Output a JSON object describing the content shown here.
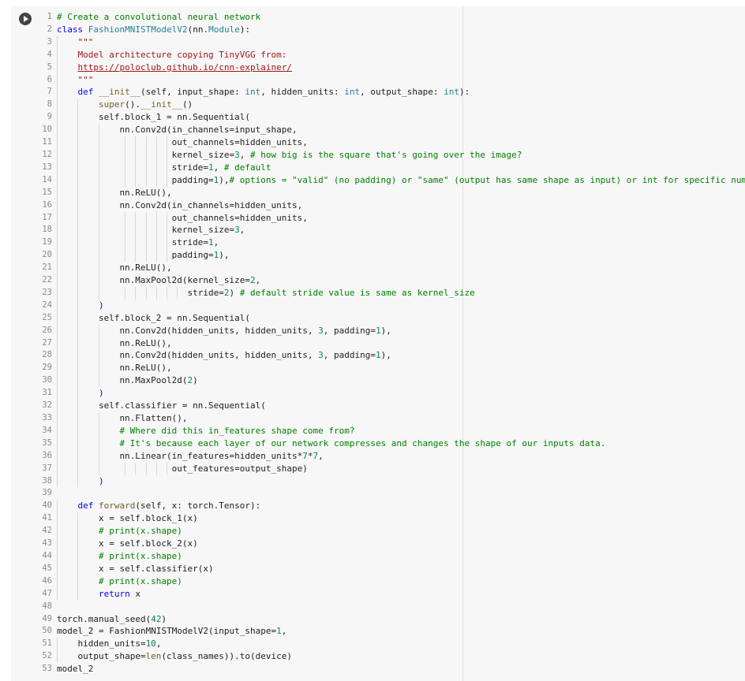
{
  "cell": {
    "run_button_label": "Run cell",
    "lines": [
      {
        "num": "1",
        "indent": 0,
        "tokens": [
          [
            "cmt",
            "# Create a convolutional neural network"
          ]
        ]
      },
      {
        "num": "2",
        "indent": 0,
        "tokens": [
          [
            "kw",
            "class "
          ],
          [
            "cls",
            "FashionMNISTModelV2"
          ],
          [
            "",
            "(nn."
          ],
          [
            "cls",
            "Module"
          ],
          [
            "",
            "):"
          ]
        ]
      },
      {
        "num": "3",
        "indent": 1,
        "tokens": [
          [
            "str",
            "\"\"\""
          ]
        ]
      },
      {
        "num": "4",
        "indent": 1,
        "tokens": [
          [
            "str",
            "Model architecture copying TinyVGG from:"
          ]
        ]
      },
      {
        "num": "5",
        "indent": 1,
        "tokens": [
          [
            "link",
            "https://poloclub.github.io/cnn-explainer/"
          ]
        ]
      },
      {
        "num": "6",
        "indent": 1,
        "tokens": [
          [
            "str",
            "\"\"\""
          ]
        ]
      },
      {
        "num": "7",
        "indent": 1,
        "tokens": [
          [
            "kw",
            "def "
          ],
          [
            "fn",
            "__init__"
          ],
          [
            "",
            "(self, input_shape: "
          ],
          [
            "cls",
            "int"
          ],
          [
            "",
            ", hidden_units: "
          ],
          [
            "cls",
            "int"
          ],
          [
            "",
            ", output_shape: "
          ],
          [
            "cls",
            "int"
          ],
          [
            "",
            "):"
          ]
        ]
      },
      {
        "num": "8",
        "indent": 2,
        "tokens": [
          [
            "fn",
            "super"
          ],
          [
            "",
            "()."
          ],
          [
            "fn",
            "__init__"
          ],
          [
            "",
            "()"
          ]
        ]
      },
      {
        "num": "9",
        "indent": 2,
        "tokens": [
          [
            "",
            "self.block_1 = nn.Sequential("
          ]
        ]
      },
      {
        "num": "10",
        "indent": 3,
        "tokens": [
          [
            "",
            "nn.Conv2d(in_channels=input_shape,"
          ]
        ]
      },
      {
        "num": "11",
        "indent": 3,
        "pad": "          ",
        "tokens": [
          [
            "",
            "out_channels=hidden_units,"
          ]
        ]
      },
      {
        "num": "12",
        "indent": 3,
        "pad": "          ",
        "tokens": [
          [
            "",
            "kernel_size="
          ],
          [
            "num",
            "3"
          ],
          [
            "",
            ", "
          ],
          [
            "cmt",
            "# how big is the square that's going over the image?"
          ]
        ]
      },
      {
        "num": "13",
        "indent": 3,
        "pad": "          ",
        "tokens": [
          [
            "",
            "stride="
          ],
          [
            "num",
            "1"
          ],
          [
            "",
            ", "
          ],
          [
            "cmt",
            "# default"
          ]
        ]
      },
      {
        "num": "14",
        "indent": 3,
        "pad": "          ",
        "tokens": [
          [
            "",
            "padding="
          ],
          [
            "num",
            "1"
          ],
          [
            "",
            "),"
          ],
          [
            "cmt",
            "# options = \"valid\" (no padding) or \"same\" (output has same shape as input) or int for specific number"
          ]
        ]
      },
      {
        "num": "15",
        "indent": 3,
        "tokens": [
          [
            "",
            "nn.ReLU(),"
          ]
        ]
      },
      {
        "num": "16",
        "indent": 3,
        "tokens": [
          [
            "",
            "nn.Conv2d(in_channels=hidden_units,"
          ]
        ]
      },
      {
        "num": "17",
        "indent": 3,
        "pad": "          ",
        "tokens": [
          [
            "",
            "out_channels=hidden_units,"
          ]
        ]
      },
      {
        "num": "18",
        "indent": 3,
        "pad": "          ",
        "tokens": [
          [
            "",
            "kernel_size="
          ],
          [
            "num",
            "3"
          ],
          [
            "",
            ","
          ]
        ]
      },
      {
        "num": "19",
        "indent": 3,
        "pad": "          ",
        "tokens": [
          [
            "",
            "stride="
          ],
          [
            "num",
            "1"
          ],
          [
            "",
            ","
          ]
        ]
      },
      {
        "num": "20",
        "indent": 3,
        "pad": "          ",
        "tokens": [
          [
            "",
            "padding="
          ],
          [
            "num",
            "1"
          ],
          [
            "",
            "),"
          ]
        ]
      },
      {
        "num": "21",
        "indent": 3,
        "tokens": [
          [
            "",
            "nn.ReLU(),"
          ]
        ]
      },
      {
        "num": "22",
        "indent": 3,
        "tokens": [
          [
            "",
            "nn.MaxPool2d(kernel_size="
          ],
          [
            "num",
            "2"
          ],
          [
            "",
            ","
          ]
        ]
      },
      {
        "num": "23",
        "indent": 3,
        "pad": "             ",
        "tokens": [
          [
            "",
            "stride="
          ],
          [
            "num",
            "2"
          ],
          [
            "",
            ") "
          ],
          [
            "cmt",
            "# default stride value is same as kernel_size"
          ]
        ]
      },
      {
        "num": "24",
        "indent": 2,
        "tokens": [
          [
            "kw",
            ")"
          ]
        ]
      },
      {
        "num": "25",
        "indent": 2,
        "tokens": [
          [
            "",
            "self.block_2 = nn.Sequential("
          ]
        ]
      },
      {
        "num": "26",
        "indent": 3,
        "tokens": [
          [
            "",
            "nn.Conv2d(hidden_units, hidden_units, "
          ],
          [
            "num",
            "3"
          ],
          [
            "",
            ", padding="
          ],
          [
            "num",
            "1"
          ],
          [
            "",
            "),"
          ]
        ]
      },
      {
        "num": "27",
        "indent": 3,
        "tokens": [
          [
            "",
            "nn.ReLU(),"
          ]
        ]
      },
      {
        "num": "28",
        "indent": 3,
        "tokens": [
          [
            "",
            "nn.Conv2d(hidden_units, hidden_units, "
          ],
          [
            "num",
            "3"
          ],
          [
            "",
            ", padding="
          ],
          [
            "num",
            "1"
          ],
          [
            "",
            "),"
          ]
        ]
      },
      {
        "num": "29",
        "indent": 3,
        "tokens": [
          [
            "",
            "nn.ReLU(),"
          ]
        ]
      },
      {
        "num": "30",
        "indent": 3,
        "tokens": [
          [
            "",
            "nn.MaxPool2d("
          ],
          [
            "num",
            "2"
          ],
          [
            "",
            ")"
          ]
        ]
      },
      {
        "num": "31",
        "indent": 2,
        "tokens": [
          [
            "kw",
            ")"
          ]
        ]
      },
      {
        "num": "32",
        "indent": 2,
        "tokens": [
          [
            "",
            "self.classifier = nn.Sequential("
          ]
        ]
      },
      {
        "num": "33",
        "indent": 3,
        "tokens": [
          [
            "",
            "nn.Flatten(),"
          ]
        ]
      },
      {
        "num": "34",
        "indent": 3,
        "tokens": [
          [
            "cmt",
            "# Where did this in_features shape come from?"
          ]
        ]
      },
      {
        "num": "35",
        "indent": 3,
        "tokens": [
          [
            "cmt",
            "# It's because each layer of our network compresses and changes the shape of our inputs data."
          ]
        ]
      },
      {
        "num": "36",
        "indent": 3,
        "tokens": [
          [
            "",
            "nn.Linear(in_features=hidden_units*"
          ],
          [
            "num",
            "7"
          ],
          [
            "",
            "*"
          ],
          [
            "num",
            "7"
          ],
          [
            "",
            ","
          ]
        ]
      },
      {
        "num": "37",
        "indent": 3,
        "pad": "          ",
        "tokens": [
          [
            "",
            "out_features=output_shape)"
          ]
        ]
      },
      {
        "num": "38",
        "indent": 2,
        "tokens": [
          [
            "kw",
            ")"
          ]
        ]
      },
      {
        "num": "39",
        "indent": 0,
        "tokens": []
      },
      {
        "num": "40",
        "indent": 1,
        "tokens": [
          [
            "kw",
            "def "
          ],
          [
            "fn",
            "forward"
          ],
          [
            "",
            "(self, x: torch.Tensor):"
          ]
        ]
      },
      {
        "num": "41",
        "indent": 2,
        "tokens": [
          [
            "",
            "x = self.block_1(x)"
          ]
        ]
      },
      {
        "num": "42",
        "indent": 2,
        "tokens": [
          [
            "cmt",
            "# print(x.shape)"
          ]
        ]
      },
      {
        "num": "43",
        "indent": 2,
        "tokens": [
          [
            "",
            "x = self.block_2(x)"
          ]
        ]
      },
      {
        "num": "44",
        "indent": 2,
        "tokens": [
          [
            "cmt",
            "# print(x.shape)"
          ]
        ]
      },
      {
        "num": "45",
        "indent": 2,
        "tokens": [
          [
            "",
            "x = self.classifier(x)"
          ]
        ]
      },
      {
        "num": "46",
        "indent": 2,
        "tokens": [
          [
            "cmt",
            "# print(x.shape)"
          ]
        ]
      },
      {
        "num": "47",
        "indent": 2,
        "tokens": [
          [
            "kw",
            "return "
          ],
          [
            "",
            "x"
          ]
        ]
      },
      {
        "num": "48",
        "indent": 0,
        "tokens": []
      },
      {
        "num": "49",
        "indent": 0,
        "tokens": [
          [
            "",
            "torch.manual_seed("
          ],
          [
            "num",
            "42"
          ],
          [
            "",
            ")"
          ]
        ]
      },
      {
        "num": "50",
        "indent": 0,
        "tokens": [
          [
            "",
            "model_2 = FashionMNISTModelV2(input_shape="
          ],
          [
            "num",
            "1"
          ],
          [
            "",
            ","
          ]
        ]
      },
      {
        "num": "51",
        "indent": 1,
        "tokens": [
          [
            "",
            "hidden_units="
          ],
          [
            "num",
            "10"
          ],
          [
            "",
            ","
          ]
        ]
      },
      {
        "num": "52",
        "indent": 1,
        "tokens": [
          [
            "",
            "output_shape="
          ],
          [
            "fn",
            "len"
          ],
          [
            "",
            "(class_names)).to(device)"
          ]
        ]
      },
      {
        "num": "53",
        "indent": 0,
        "tokens": [
          [
            "",
            "model_2"
          ]
        ]
      }
    ]
  }
}
